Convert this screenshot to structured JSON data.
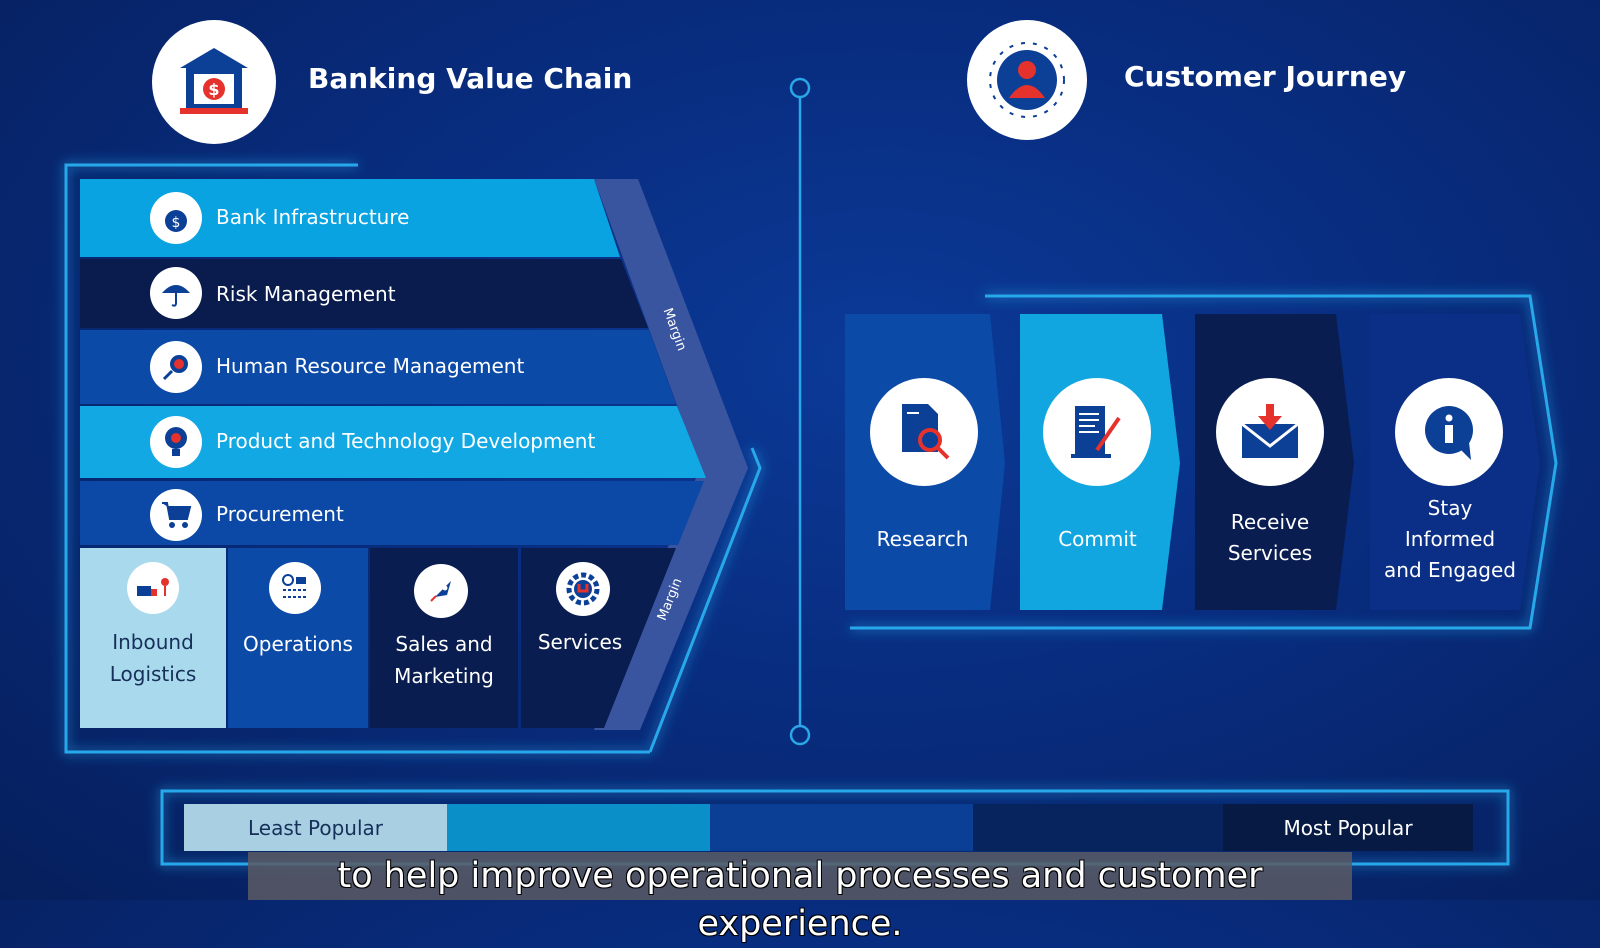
{
  "value_chain": {
    "title": "Banking Value Chain",
    "icon": "bank-icon",
    "support_activities": [
      {
        "label": "Bank Infrastructure",
        "icon": "dollar-bag-icon",
        "color": "#0aa3e2"
      },
      {
        "label": "Risk Management",
        "icon": "umbrella-icon",
        "color": "#0a1b4d"
      },
      {
        "label": "Human Resource Management",
        "icon": "search-person-icon",
        "color": "#0c4aa8"
      },
      {
        "label": "Product and Technology Development",
        "icon": "lightbulb-icon",
        "color": "#12a8e3"
      },
      {
        "label": "Procurement",
        "icon": "cart-icon",
        "color": "#0c49a6"
      }
    ],
    "primary_activities": [
      {
        "line1": "Inbound",
        "line2": "Logistics",
        "icon": "truck-icon",
        "color": "#a9d9ec",
        "text_color": "#16305a"
      },
      {
        "line1": "Operations",
        "line2": "",
        "icon": "workflow-icon",
        "color": "#0c4aa8",
        "text_color": "#ffffff"
      },
      {
        "line1": "Sales and",
        "line2": "Marketing",
        "icon": "rocket-icon",
        "color": "#0a1d50",
        "text_color": "#ffffff"
      },
      {
        "line1": "Services",
        "line2": "",
        "icon": "gear-wrench-icon",
        "color": "#0a1d50",
        "text_color": "#ffffff"
      }
    ],
    "margin_label_top": "Margin",
    "margin_label_bottom": "Margin"
  },
  "customer_journey": {
    "title": "Customer Journey",
    "icon": "person-icon",
    "steps": [
      {
        "line1": "Research",
        "line2": "",
        "line3": "",
        "icon": "document-search-icon",
        "color": "#0c4aa8"
      },
      {
        "line1": "Commit",
        "line2": "",
        "line3": "",
        "icon": "contract-sign-icon",
        "color": "#12a6e0"
      },
      {
        "line1": "Receive",
        "line2": "Services",
        "line3": "",
        "icon": "envelope-download-icon",
        "color": "#0a1d50"
      },
      {
        "line1": "Stay",
        "line2": "Informed",
        "line3": "and Engaged",
        "icon": "info-chat-icon",
        "color": "#0b2f86"
      }
    ]
  },
  "popularity_legend": {
    "least_label": "Least Popular",
    "most_label": "Most Popular",
    "colors": [
      "#a8d0e2",
      "#0b8fc8",
      "#0a3f95",
      "#07245e",
      "#071a44"
    ]
  },
  "caption": "to help improve operational processes and customer experience."
}
